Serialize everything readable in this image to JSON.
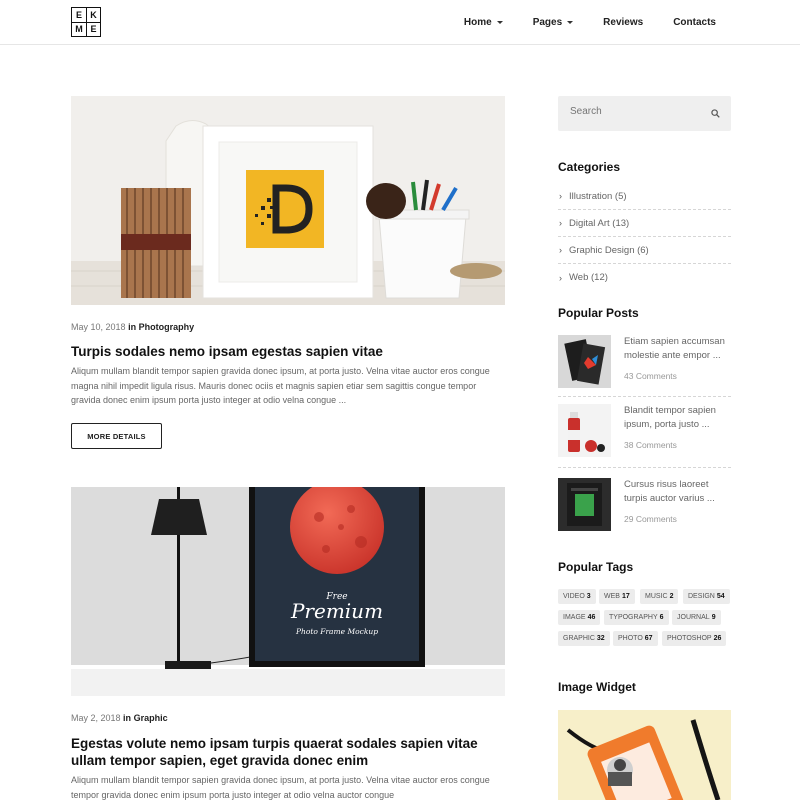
{
  "header": {
    "logo_letters": [
      "E",
      "K",
      "M",
      "E"
    ],
    "nav": [
      {
        "label": "Home",
        "dropdown": true
      },
      {
        "label": "Pages",
        "dropdown": true
      },
      {
        "label": "Reviews",
        "dropdown": false
      },
      {
        "label": "Contacts",
        "dropdown": false
      }
    ]
  },
  "posts": [
    {
      "date": "May 10, 2018",
      "in_word": "in",
      "category": "Photography",
      "title": "Turpis sodales nemo ipsam egestas sapien vitae",
      "excerpt": "Aliqum mullam blandit tempor sapien gravida donec ipsum, at porta justo. Velna vitae auctor eros congue magna nihil impedit ligula risus. Mauris donec ociis et magnis sapien etiar          sem sagittis congue tempor gravida donec enim ipsum porta justo integer at odio velna congue          ...",
      "button": "MORE DETAILS"
    },
    {
      "date": "May 2, 2018",
      "in_word": "in",
      "category": "Graphic",
      "title": "Egestas volute nemo ipsam turpis quaerat sodales sapien vitae ullam tempor sapien, eget gravida donec enim",
      "excerpt": "Aliqum mullam blandit tempor sapien gravida donec ipsum, at porta justo. Velna vitae auctor eros congue tempor gravida donec enim ipsum porta justo integer at odio velna auctor congue"
    }
  ],
  "poster": {
    "line1": "Free",
    "line2": "Premium",
    "line3": "Photo Frame Mockup"
  },
  "sidebar": {
    "search_placeholder": "Search",
    "categories_title": "Categories",
    "categories": [
      {
        "label": "Illustration (5)"
      },
      {
        "label": "Digital Art (13)"
      },
      {
        "label": "Graphic Design (6)"
      },
      {
        "label": "Web (12)"
      }
    ],
    "popular_posts_title": "Popular Posts",
    "popular_posts": [
      {
        "title": "Etiam sapien accumsan molestie ante empor ...",
        "comments": "43 Comments"
      },
      {
        "title": "Blandit tempor sapien ipsum, porta justo ...",
        "comments": "38 Comments"
      },
      {
        "title": "Cursus risus laoreet turpis auctor varius ...",
        "comments": "29 Comments"
      }
    ],
    "popular_tags_title": "Popular Tags",
    "tags": [
      {
        "name": "VIDEO",
        "count": "3"
      },
      {
        "name": "WEB",
        "count": "17"
      },
      {
        "name": "MUSIC",
        "count": "2"
      },
      {
        "name": "DESIGN",
        "count": "54"
      },
      {
        "name": "IMAGE",
        "count": "46"
      },
      {
        "name": "TYPOGRAPHY",
        "count": "6"
      },
      {
        "name": "JOURNAL",
        "count": "9"
      },
      {
        "name": "GRAPHIC",
        "count": "32"
      },
      {
        "name": "PHOTO",
        "count": "67"
      },
      {
        "name": "PHOTOSHOP",
        "count": "26"
      }
    ],
    "image_widget_title": "Image Widget"
  },
  "colors": {
    "accent_yellow": "#f2b624",
    "poster_bg": "#263241",
    "planet_red": "#e2493a",
    "tag_bg": "#ececec"
  }
}
